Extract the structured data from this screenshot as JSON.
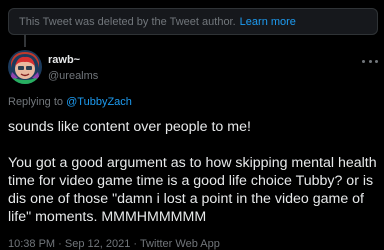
{
  "banner": {
    "text": "This Tweet was deleted by the Tweet author.",
    "link": "Learn more"
  },
  "author": {
    "display_name": "rawb~",
    "username": "@urealms"
  },
  "reply": {
    "prefix": "Replying to",
    "mention": "@TubbyZach"
  },
  "tweet": {
    "text": "sounds like content over people to me!\n\nYou got a good argument as to how skipping mental health time for video game time is a good life choice Tubby? or is dis one of those \"damn i lost a point in the video game of life\" moments. MMMHMMMMM"
  },
  "meta": {
    "time": "10:38 PM",
    "sep1": "·",
    "date": "Sep 12, 2021",
    "sep2": "·",
    "client": "Twitter Web App"
  },
  "colors": {
    "accent": "#1d9bf0",
    "muted": "#71767b",
    "text": "#e7e9ea",
    "background": "#000000"
  },
  "icons": {
    "more": "more-horizontal-icon",
    "badge": "verified-emblem-icon"
  }
}
